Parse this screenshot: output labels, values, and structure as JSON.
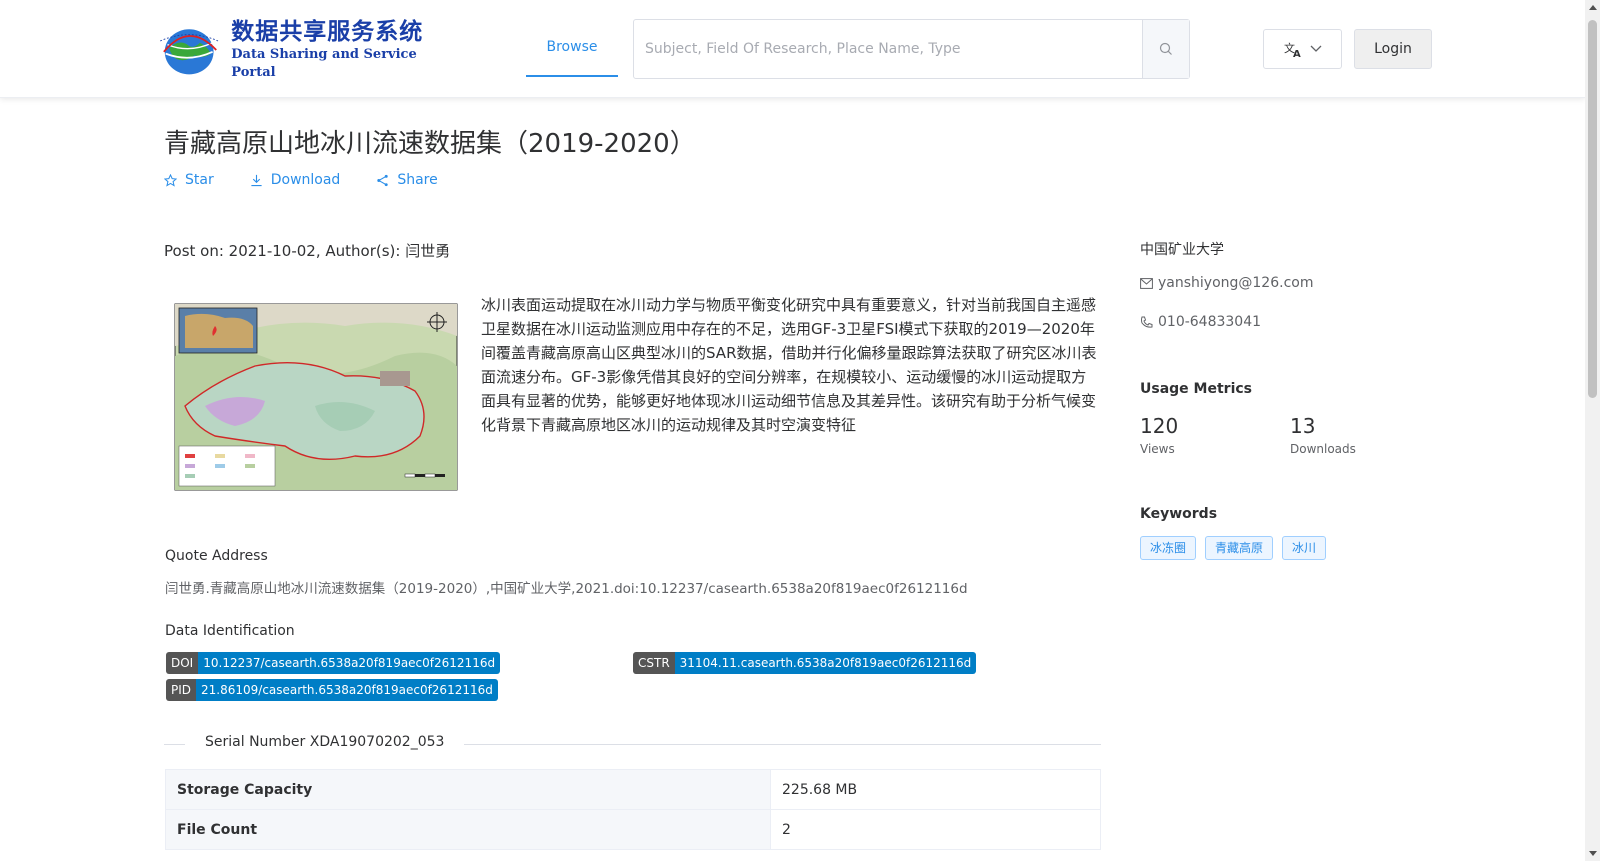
{
  "header": {
    "logo_cn": "数据共享服务系统",
    "logo_en": "Data Sharing and Service Portal",
    "nav_browse": "Browse",
    "search_placeholder": "Subject, Field Of Research, Place Name, Type",
    "login": "Login",
    "accent_color": "#2b8ee8"
  },
  "dataset": {
    "title": "青藏高原山地冰川流速数据集（2019-2020）",
    "actions": {
      "star": "Star",
      "download": "Download",
      "share": "Share"
    },
    "post_on": "Post on: 2021-10-02, Author(s): 闫世勇",
    "abstract": "冰川表面运动提取在冰川动力学与物质平衡变化研究中具有重要意义，针对当前我国自主遥感卫星数据在冰川运动监测应用中存在的不足，选用GF-3卫星FSI模式下获取的2019—2020年间覆盖青藏高原高山区典型冰川的SAR数据，借助并行化偏移量跟踪算法获取了研究区冰川表面流速分布。GF-3影像凭借其良好的空间分辨率，在规模较小、运动缓慢的冰川运动提取方面具有显著的优势，能够更好地体现冰川运动细节信息及其差异性。该研究有助于分析气候变化背景下青藏高原地区冰川的运动规律及其时空演变特征",
    "quote_label": "Quote Address",
    "quote_text": "闫世勇.青藏高原山地冰川流速数据集（2019-2020）,中国矿业大学,2021.doi:10.12237/casearth.6538a20f819aec0f2612116d",
    "data_id_label": "Data Identification",
    "doi_key": "DOI",
    "doi_val": "10.12237/casearth.6538a20f819aec0f2612116d",
    "cstr_key": "CSTR",
    "cstr_val": "31104.11.casearth.6538a20f819aec0f2612116d",
    "pid_key": "PID",
    "pid_val": "21.86109/casearth.6538a20f819aec0f2612116d",
    "serial": "Serial Number XDA19070202_053",
    "table": [
      {
        "key": "Storage Capacity",
        "value": "225.68 MB"
      },
      {
        "key": "File Count",
        "value": "2"
      }
    ]
  },
  "sidebar": {
    "org": "中国矿业大学",
    "email": "yanshiyong@126.com",
    "phone": "010-64833041",
    "metrics_title": "Usage Metrics",
    "views_num": "120",
    "views_lbl": "Views",
    "downloads_num": "13",
    "downloads_lbl": "Downloads",
    "keywords_title": "Keywords",
    "keywords": [
      "冰冻圈",
      "青藏高原",
      "冰川"
    ]
  }
}
